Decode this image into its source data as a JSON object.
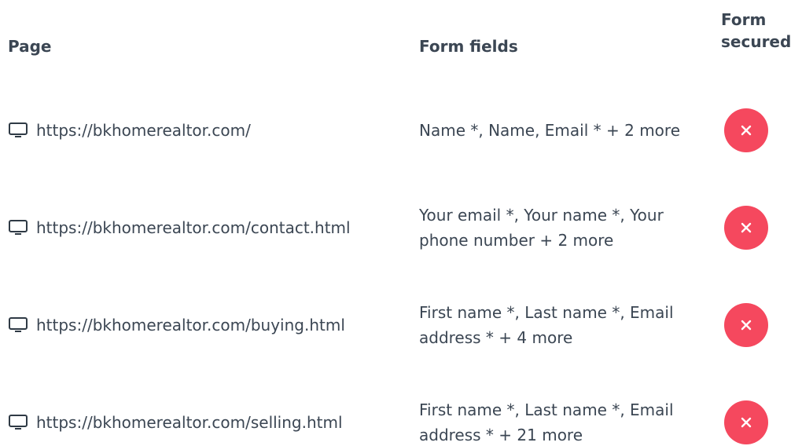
{
  "header": {
    "page": "Page",
    "form_fields": "Form fields",
    "form_secured_line1": "Form",
    "form_secured_line2": "secured"
  },
  "rows": [
    {
      "url": "https://bkhomerealtor.com/",
      "fields": "Name *, Name, Email * + 2 more",
      "secured_status": "not-secured",
      "device_icon": "desktop-monitor-icon",
      "status_icon": "x-icon"
    },
    {
      "url": "https://bkhomerealtor.com/contact.html",
      "fields": "Your email *, Your name *, Your phone number + 2 more",
      "secured_status": "not-secured",
      "device_icon": "desktop-monitor-icon",
      "status_icon": "x-icon"
    },
    {
      "url": "https://bkhomerealtor.com/buying.html",
      "fields": "First name *, Last name *, Email address * + 4 more",
      "secured_status": "not-secured",
      "device_icon": "desktop-monitor-icon",
      "status_icon": "x-icon"
    },
    {
      "url": "https://bkhomerealtor.com/selling.html",
      "fields": "First name *, Last name *, Email address * + 21 more",
      "secured_status": "not-secured",
      "device_icon": "desktop-monitor-icon",
      "status_icon": "x-icon"
    }
  ],
  "colors": {
    "text": "#3b4653",
    "badge_red": "#f5485e"
  }
}
